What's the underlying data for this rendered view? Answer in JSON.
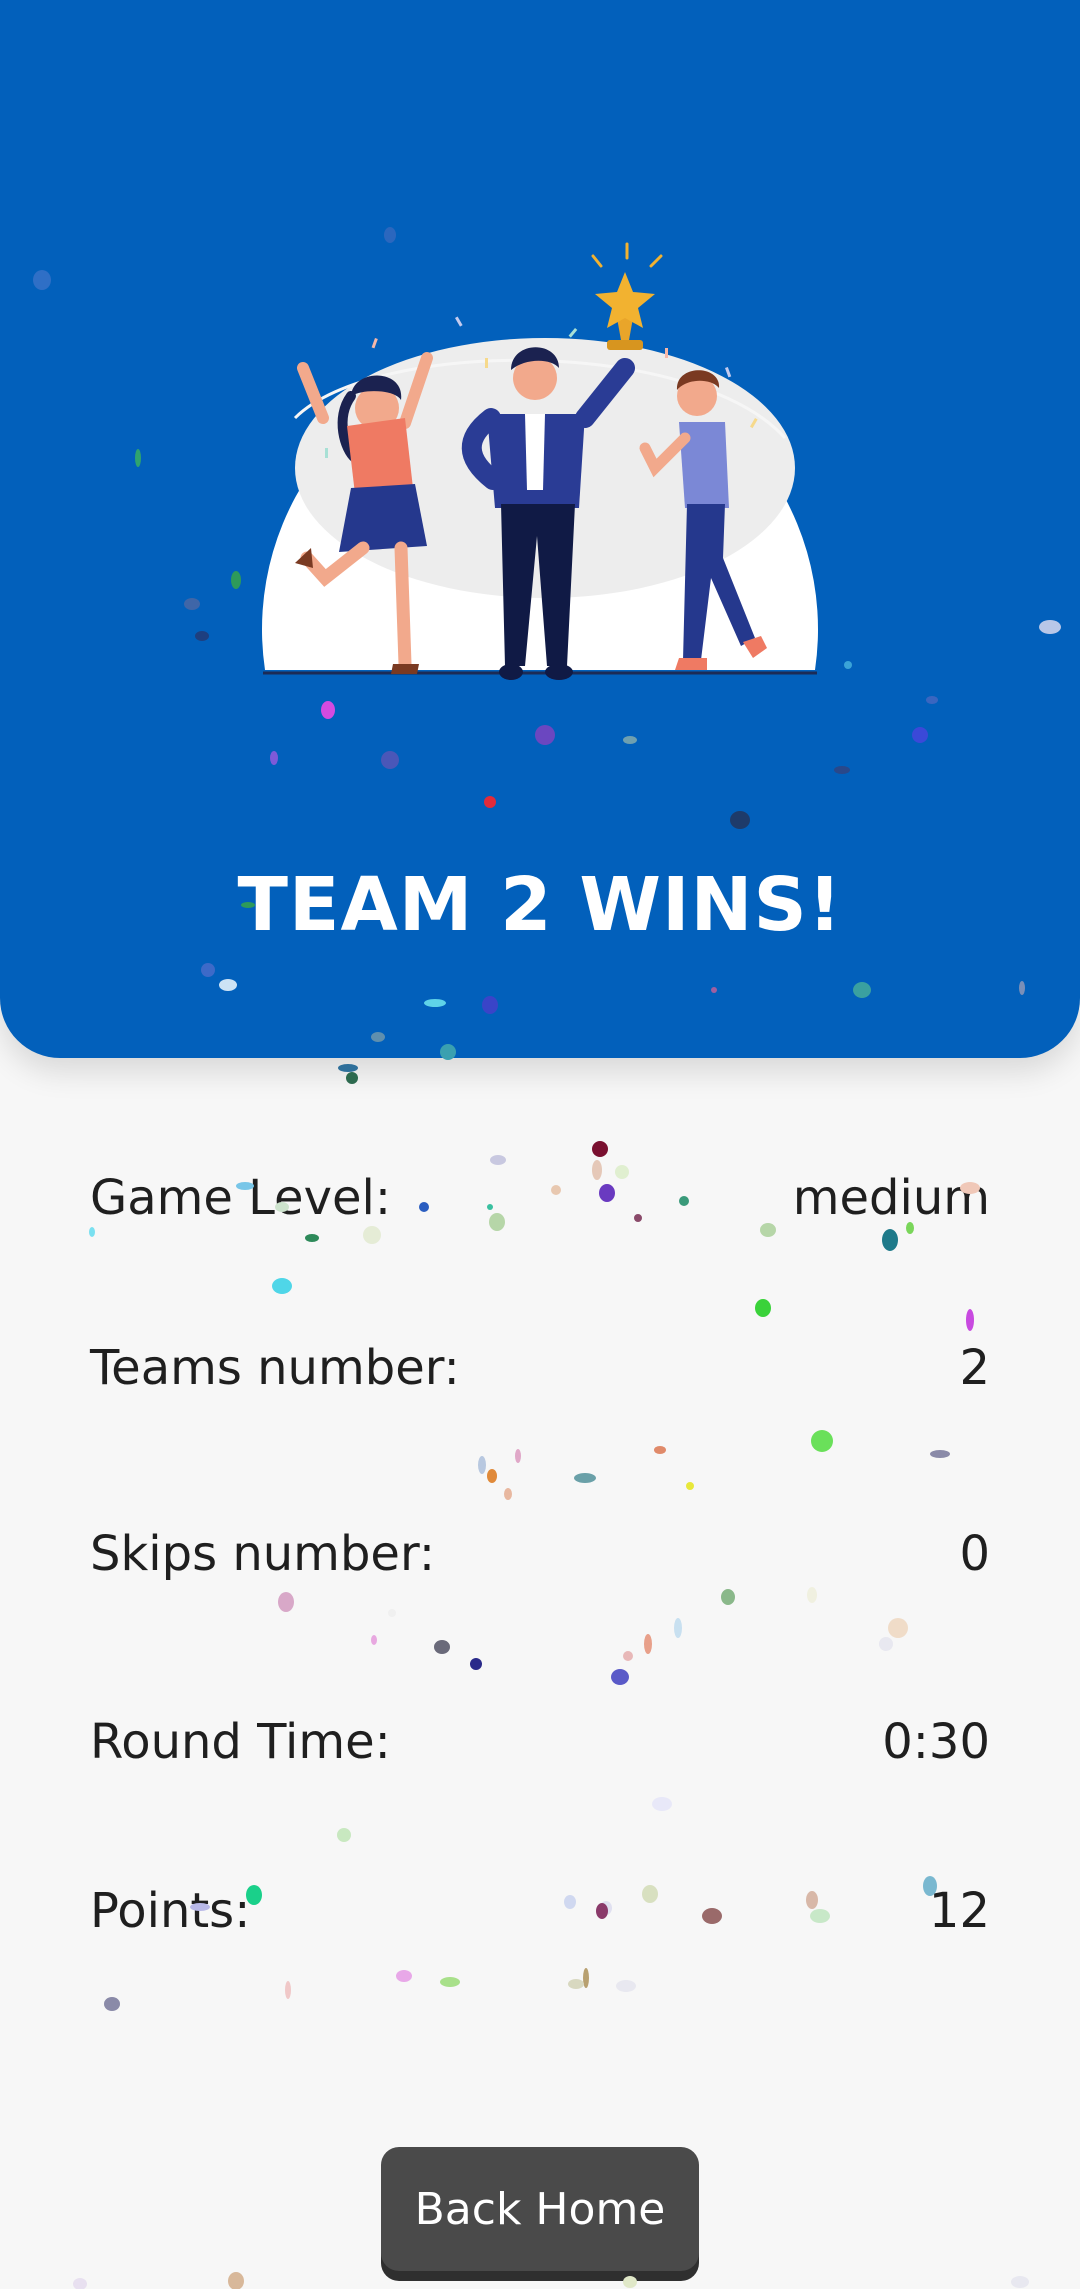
{
  "result": {
    "title": "TEAM 2 WINS!"
  },
  "stats": [
    {
      "label": "Game Level:",
      "value": "medium"
    },
    {
      "label": "Teams number:",
      "value": "2"
    },
    {
      "label": "Skips number:",
      "value": "0"
    },
    {
      "label": "Round Time:",
      "value": "0:30"
    },
    {
      "label": "Points:",
      "value": "12"
    }
  ],
  "actions": {
    "back_home_label": "Back Home"
  },
  "colors": {
    "hero_bg": "#0260bb",
    "button_bg": "#4a4a4a",
    "page_bg": "#f7f7f7",
    "trophy": "#f2b230"
  },
  "icons": {
    "illustration": "celebrating-team-trophy-illustration"
  }
}
